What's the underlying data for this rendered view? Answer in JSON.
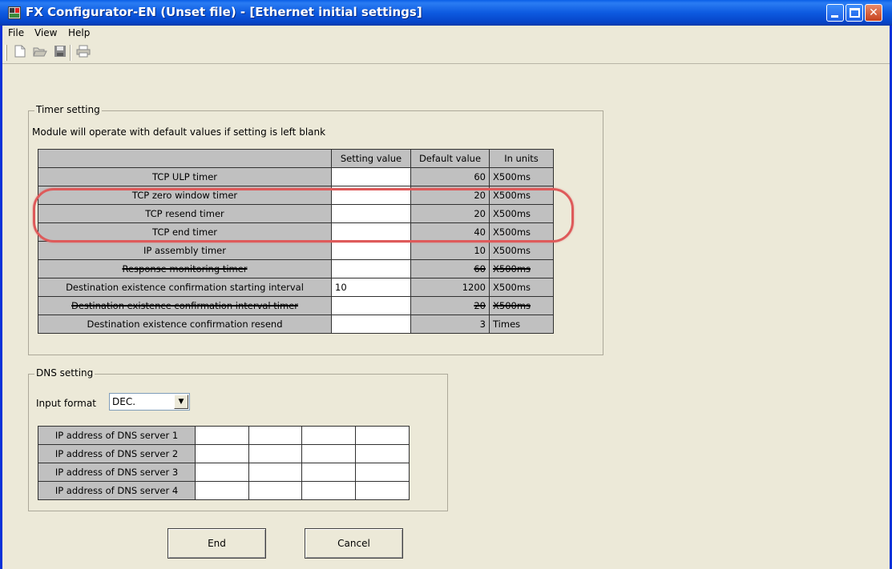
{
  "window": {
    "title": "FX Configurator-EN (Unset file) - [Ethernet initial settings]"
  },
  "menu": [
    "File",
    "View",
    "Help"
  ],
  "toolbar": {
    "icons": [
      "new-file-icon",
      "open-folder-icon",
      "save-disk-icon",
      "print-icon"
    ]
  },
  "timer_setting": {
    "group_title": "Timer setting",
    "note": "Module will operate with default values if setting is left blank",
    "headers": [
      "",
      "Setting value",
      "Default value",
      "In units"
    ],
    "rows": [
      {
        "label": "TCP ULP timer",
        "setting": "",
        "default": "60",
        "units": "X500ms"
      },
      {
        "label": "TCP zero window timer",
        "setting": "",
        "default": "20",
        "units": "X500ms"
      },
      {
        "label": "TCP resend timer",
        "setting": "",
        "default": "20",
        "units": "X500ms"
      },
      {
        "label": "TCP end timer",
        "setting": "",
        "default": "40",
        "units": "X500ms"
      },
      {
        "label": "IP assembly timer",
        "setting": "",
        "default": "10",
        "units": "X500ms"
      },
      {
        "label": "Response monitoring timer",
        "setting": "",
        "default": "60",
        "units": "X500ms"
      },
      {
        "label": "Destination existence confirmation starting interval",
        "setting": "10",
        "default": "1200",
        "units": "X500ms"
      },
      {
        "label": "Destination existence confirmation interval timer",
        "setting": "",
        "default": "20",
        "units": "X500ms"
      },
      {
        "label": "Destination existence confirmation resend",
        "setting": "",
        "default": "3",
        "units": "Times"
      }
    ]
  },
  "dns_setting": {
    "group_title": "DNS setting",
    "input_format_label": "Input format",
    "input_format_value": "DEC.",
    "servers": [
      {
        "label": "IP address of DNS server 1",
        "octets": [
          "",
          "",
          "",
          ""
        ]
      },
      {
        "label": "IP address of DNS server 2",
        "octets": [
          "",
          "",
          "",
          ""
        ]
      },
      {
        "label": "IP address of DNS server 3",
        "octets": [
          "",
          "",
          "",
          ""
        ]
      },
      {
        "label": "IP address of DNS server 4",
        "octets": [
          "",
          "",
          "",
          ""
        ]
      }
    ]
  },
  "buttons": {
    "end_label": "End",
    "cancel_label": "Cancel"
  },
  "colors": {
    "highlight": "#de5a5a",
    "titlebar": "#0a5fe8",
    "cell_gray": "#c0c0c0"
  }
}
